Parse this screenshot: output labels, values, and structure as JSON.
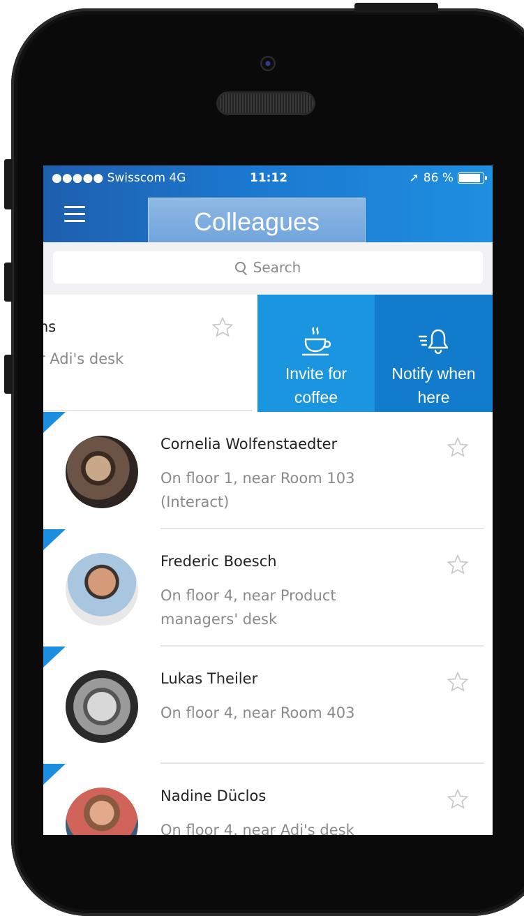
{
  "status_bar": {
    "carrier": "●●●●● Swisscom  4G",
    "time": "11:12",
    "battery": "86 %",
    "location_arrow": "➚"
  },
  "header": {
    "title": "Colleagues",
    "menu_icon": "hamburger-icon"
  },
  "search": {
    "placeholder": "Search"
  },
  "swiped_row": {
    "partial_name": "ns",
    "partial_location": "r Adi's desk",
    "actions": [
      {
        "label_line1": "Invite for",
        "label_line2": "coffee",
        "icon": "coffee-cup-icon"
      },
      {
        "label_line1": "Notify when",
        "label_line2": "here",
        "icon": "bell-icon"
      }
    ]
  },
  "contacts": [
    {
      "name": "Cornelia Wolfenstaedter",
      "location": "On floor 1, near Room 103 (Interact)"
    },
    {
      "name": "Frederic Boesch",
      "location": "On floor 4, near Product managers' desk"
    },
    {
      "name": "Lukas Theiler",
      "location": "On floor 4, near Room 403"
    },
    {
      "name": "Nadine Düclos",
      "location": "On floor 4, near Adi's desk"
    }
  ],
  "colors": {
    "header_blue": "#1b78cf",
    "action_coffee": "#1a96e0",
    "action_notify": "#117ccb",
    "flag_blue": "#1b8ee0"
  }
}
